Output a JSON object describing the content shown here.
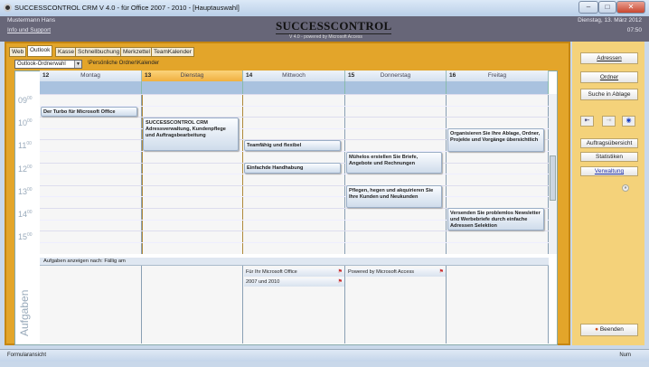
{
  "window": {
    "title": "SUCCESSCONTROL CRM V 4.0 - für Office 2007 - 2010 - [Hauptauswahl]",
    "minimize": "–",
    "maximize": "□",
    "close": "✕"
  },
  "header": {
    "user": "Mustermann Hans",
    "info_link": "Info und Support",
    "logo": "SUCCESSCONTROL",
    "version": "V 4.0 - powered by Microsoft Access",
    "date": "Dienstag, 13. März 2012",
    "time": "07:50"
  },
  "tabs": [
    {
      "label": "Web"
    },
    {
      "label": "Outlook",
      "active": true
    },
    {
      "label": "Kasse"
    },
    {
      "label": "Schnellbuchung"
    },
    {
      "label": "Merkzettel"
    },
    {
      "label": "TeamKalender"
    }
  ],
  "folder_select": {
    "value": "Outlook-Ordnerwahl",
    "path": "\\Persönliche Ordner\\Kalender"
  },
  "calendar": {
    "days": [
      {
        "num": "12",
        "name": "Montag"
      },
      {
        "num": "13",
        "name": "Dienstag",
        "today": true
      },
      {
        "num": "14",
        "name": "Mittwoch"
      },
      {
        "num": "15",
        "name": "Donnerstag"
      },
      {
        "num": "16",
        "name": "Freitag"
      }
    ],
    "hours": [
      {
        "h": "09",
        "m": "00"
      },
      {
        "h": "10",
        "m": "00"
      },
      {
        "h": "11",
        "m": "00"
      },
      {
        "h": "12",
        "m": "00"
      },
      {
        "h": "13",
        "m": "00"
      },
      {
        "h": "14",
        "m": "00"
      },
      {
        "h": "15",
        "m": "00"
      }
    ],
    "events": [
      {
        "day": "Montag",
        "text": "Der Turbo für Microsoft Office"
      },
      {
        "day": "Dienstag",
        "text": "SUCCESSCONTROL CRM Adressverwaltung, Kundenpflege und Auftragsbearbeitung"
      },
      {
        "day": "Mittwoch",
        "text": "Teamfähig und flexibel"
      },
      {
        "day": "Mittwoch",
        "text": "Einfachde Handhabung"
      },
      {
        "day": "Donnerstag",
        "text": "Mühelos erstellen Sie Briefe, Angebote und Rechnungen"
      },
      {
        "day": "Donnerstag",
        "text": "Pflegen, hegen und akquirieren Sie Ihre Kunden und Neukunden"
      },
      {
        "day": "Freitag",
        "text": "Organisieren Sie Ihre Ablage, Ordner, Projekte und Vorgänge übersichtlich"
      },
      {
        "day": "Freitag",
        "text": "Versenden Sie problemlos Newsletter und Werbebriefe durch einfache Adressen Selektion"
      }
    ],
    "tasks_header": "Aufgaben anzeigen nach: Fällig am",
    "tasks_label": "Aufgaben",
    "tasks": [
      {
        "day": "Mittwoch",
        "text": "Für Ihr Microsoft Office"
      },
      {
        "day": "Mittwoch",
        "text": "2007 und 2010"
      },
      {
        "day": "Donnerstag",
        "text": "Powered by Microsoft Access"
      }
    ]
  },
  "sidebar": {
    "adressen": "Adressen",
    "ordner": "Ordner",
    "suche": "Suche in Ablage",
    "icons": [
      "import-icon",
      "export-icon",
      "outlook-icon"
    ],
    "auftrag": "Auftragsübersicht",
    "statistiken": "Statistiken",
    "verwaltung": "Verwaltung",
    "beenden": "Beenden"
  },
  "status": {
    "left": "Formularansicht",
    "right": "Num"
  }
}
